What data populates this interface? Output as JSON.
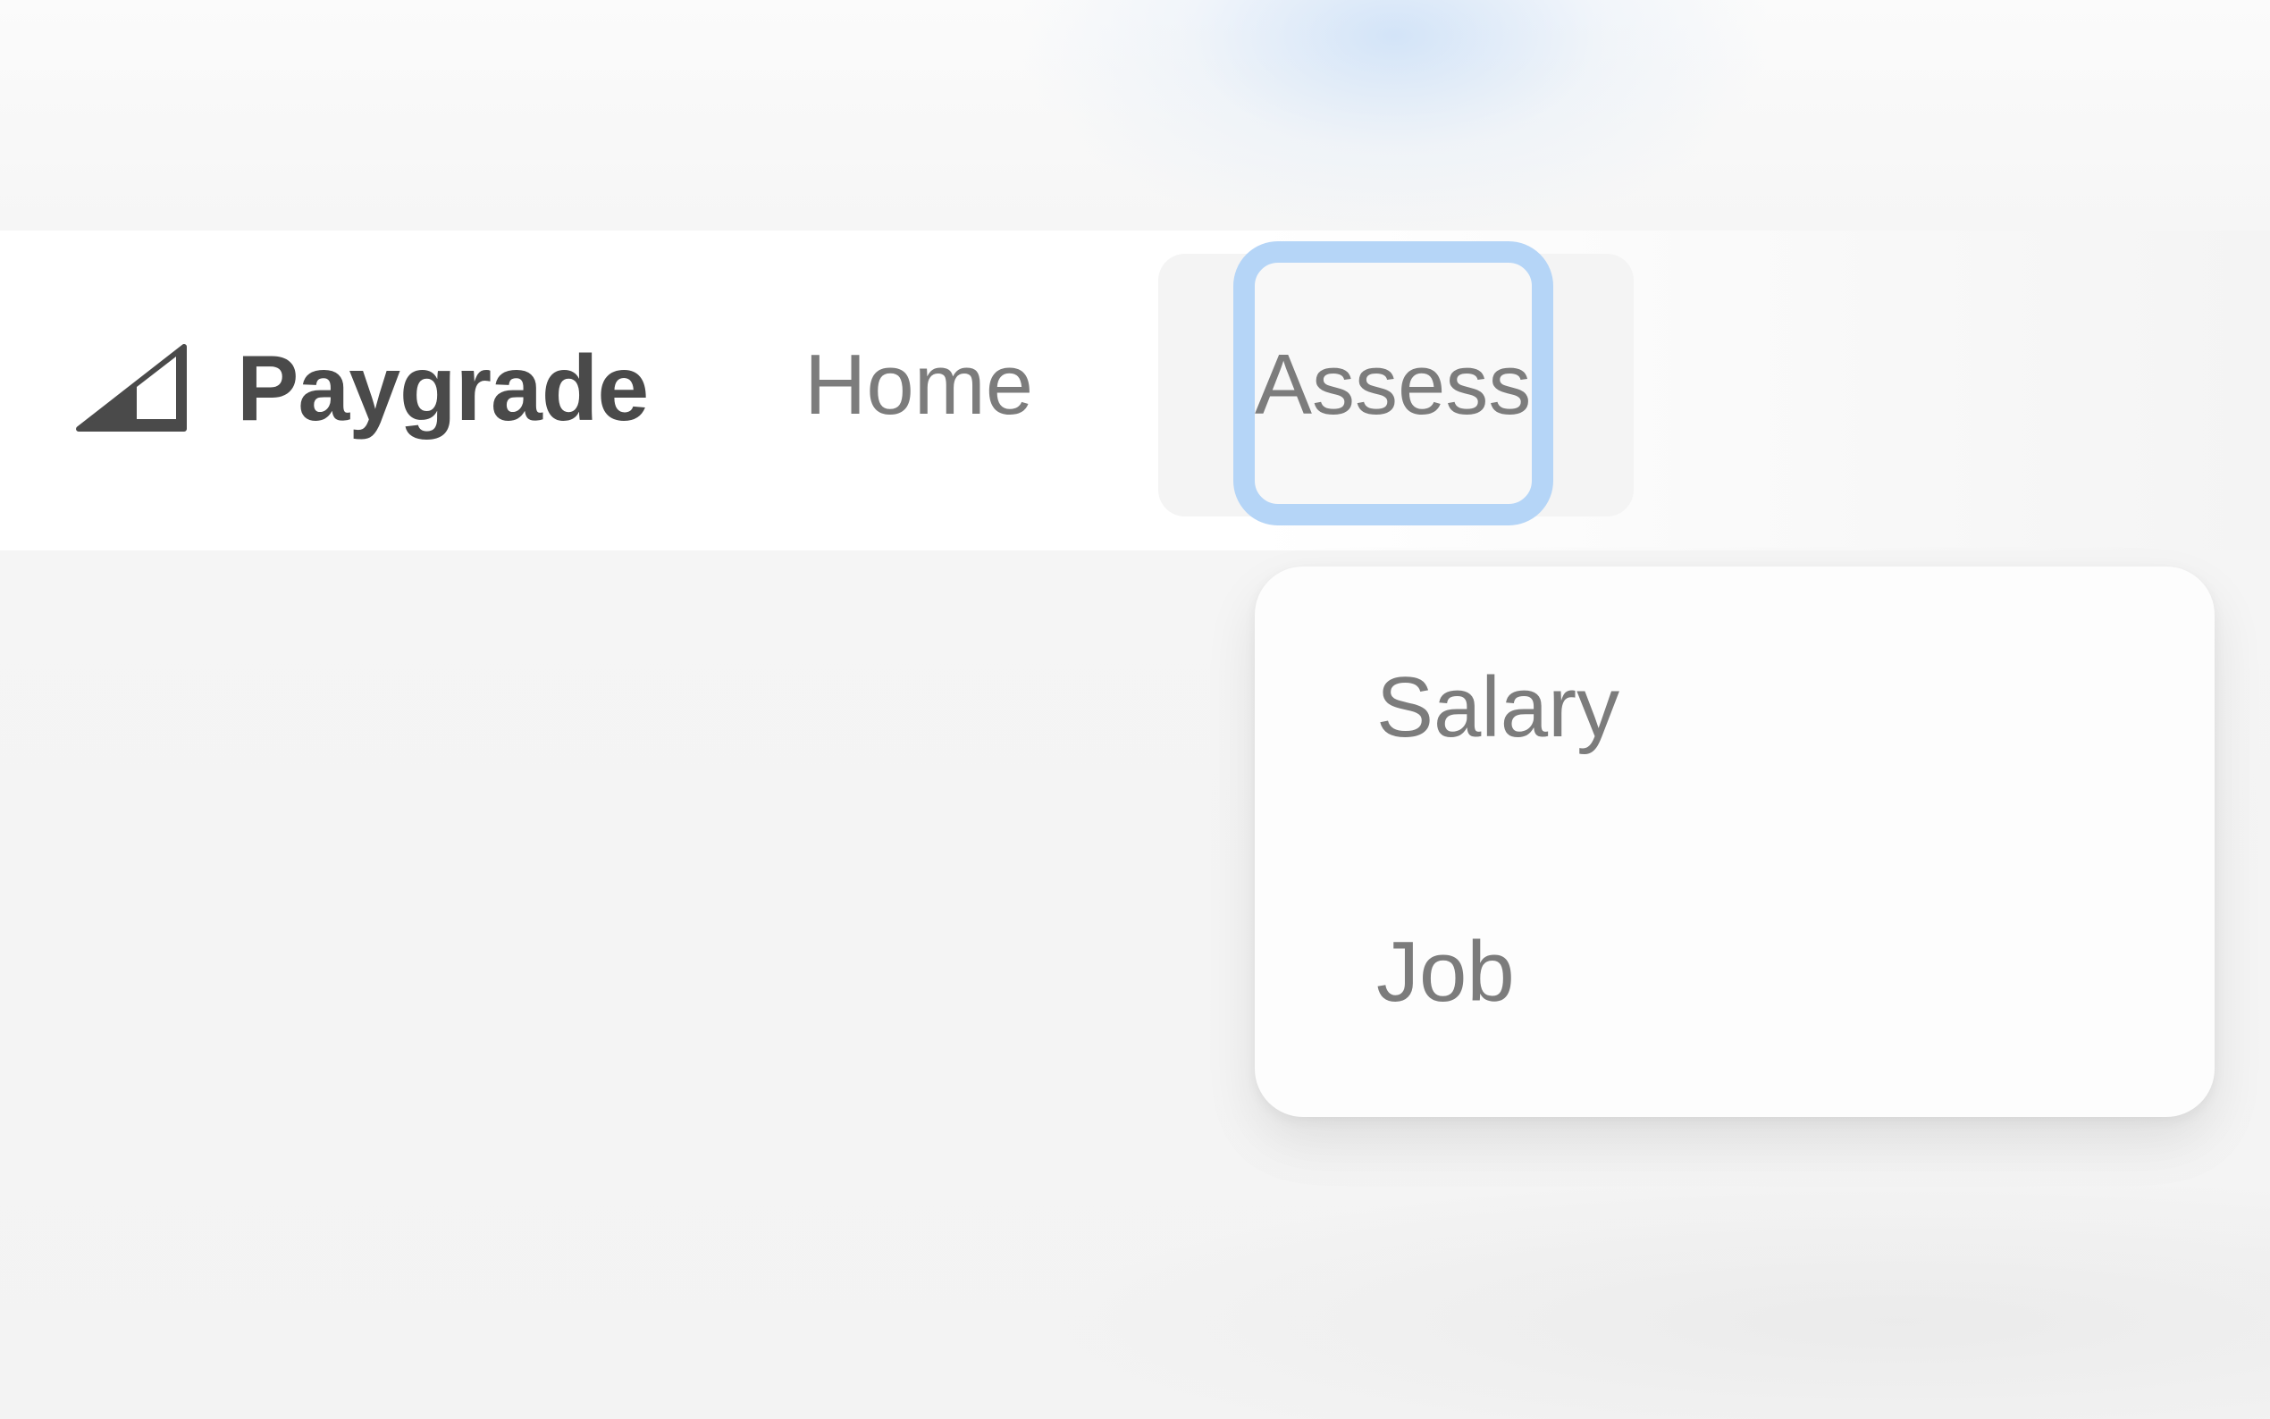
{
  "brand": {
    "name": "Paygrade",
    "icon": "signal-triangle-icon"
  },
  "nav": {
    "items": [
      {
        "label": "Home"
      },
      {
        "label": "Assess",
        "state": "focused",
        "expanded": true
      }
    ]
  },
  "assess_menu": {
    "items": [
      {
        "label": "Salary"
      },
      {
        "label": "Job"
      }
    ]
  },
  "colors": {
    "focus_ring": "#b5d5f7",
    "text_muted": "#7c7c7c",
    "brand_text": "#4a4a4a"
  }
}
